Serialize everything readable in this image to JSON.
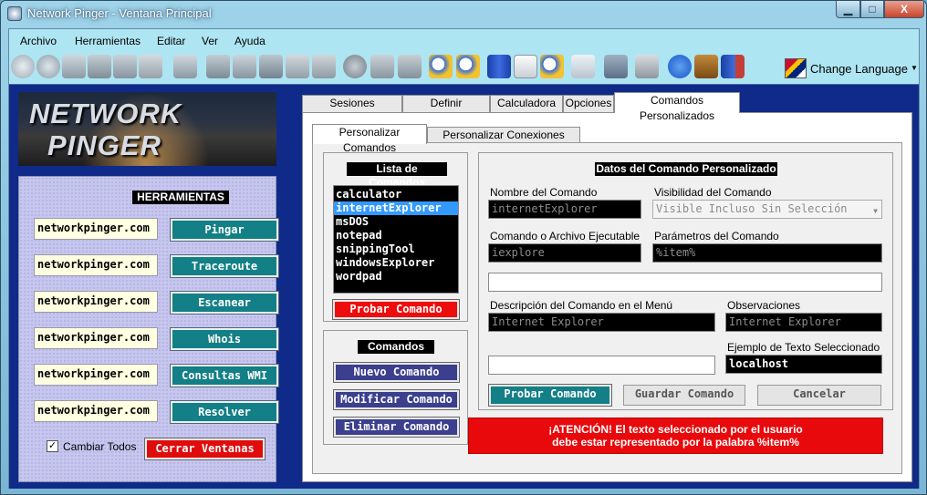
{
  "window": {
    "title": "Network Pinger - Ventana Principal",
    "minimize_label": "▁",
    "maximize_label": "□",
    "close_label": "X"
  },
  "menubar": {
    "items": [
      "Archivo",
      "Herramientas",
      "Editar",
      "Ver",
      "Ayuda"
    ]
  },
  "toolbar": {
    "icons": [
      "ping-icon",
      "magnify-globe-icon",
      "network-ip-icon",
      "traceroute-icon",
      "scan-grid-icon",
      "wmi-icon",
      "ship-icon",
      "network-computers-icon",
      "picture-icon",
      "monitor-icon",
      "cable-icon",
      "plug-icon",
      "whois-icon",
      "bank-icon",
      "handshake-icon",
      "zoom-in-icon",
      "zoom-out-icon",
      "server-icon",
      "copy-icon",
      "find-icon",
      "dictionary-icon",
      "save-icon",
      "printer-icon",
      "help-icon",
      "toolbox-icon",
      "exit-door-icon"
    ],
    "change_language_label": "Change Language"
  },
  "logo": {
    "line1": "NETWORK",
    "line2": "PINGER"
  },
  "tools": {
    "title": "HERRAMIENTAS",
    "rows": [
      {
        "value": "networkpinger.com",
        "button": "Pingar"
      },
      {
        "value": "networkpinger.com",
        "button": "Traceroute"
      },
      {
        "value": "networkpinger.com",
        "button": "Escanear"
      },
      {
        "value": "networkpinger.com",
        "button": "Whois"
      },
      {
        "value": "networkpinger.com",
        "button": "Consultas WMI"
      },
      {
        "value": "networkpinger.com",
        "button": "Resolver"
      }
    ],
    "change_all_label": "Cambiar Todos",
    "change_all_checked": true,
    "close_windows_label": "Cerrar Ventanas"
  },
  "tabs": [
    "Sesiones Guardadas",
    "Definir Anfitriones",
    "Calculadora IP",
    "Opciones",
    "Comandos Personalizados"
  ],
  "active_tab": "Comandos Personalizados",
  "subtabs": [
    "Personalizar Comandos",
    "Personalizar Conexiones Remotas"
  ],
  "commands_list": {
    "title": "Lista de Comandos",
    "items": [
      "calculator",
      "internetExplorer",
      "msDOS",
      "notepad",
      "snippingTool",
      "windowsExplorer",
      "wordpad"
    ],
    "selected": "internetExplorer",
    "test_button": "Probar Comando"
  },
  "commands": {
    "title": "Comandos",
    "new_button": "Nuevo Comando",
    "modify_button": "Modificar Comando",
    "delete_button": "Eliminar Comando"
  },
  "details": {
    "title": "Datos del Comando Personalizado",
    "name_label": "Nombre del Comando",
    "name_value": "internetExplorer",
    "visibility_label": "Visibilidad del Comando",
    "visibility_value": "Visible Incluso Sin Selección",
    "exec_label": "Comando o Archivo Ejecutable",
    "exec_value": "iexplore",
    "params_label": "Parámetros del Comando",
    "params_value": "%item%",
    "preview_value": "",
    "desc_label": "Descripción del Comando en el Menú",
    "desc_value": "Internet Explorer",
    "obs_label": "Observaciones",
    "obs_value": "Internet Explorer",
    "sample_input_value": "",
    "sample_label": "Ejemplo de Texto Seleccionado",
    "sample_value": "localhost",
    "test_button": "Probar Comando",
    "save_button": "Guardar Comando",
    "cancel_button": "Cancelar",
    "alert_line1": "¡ATENCIÓN! El texto seleccionado por el usuario",
    "alert_line2": "debe estar representado por la palabra %item%"
  },
  "colors": {
    "teal_button": "#137f86",
    "red_button": "#ee0d0d",
    "purple_button": "#3b3f8e",
    "selection": "#3399ff",
    "panel_blue": "#0f2a88"
  }
}
